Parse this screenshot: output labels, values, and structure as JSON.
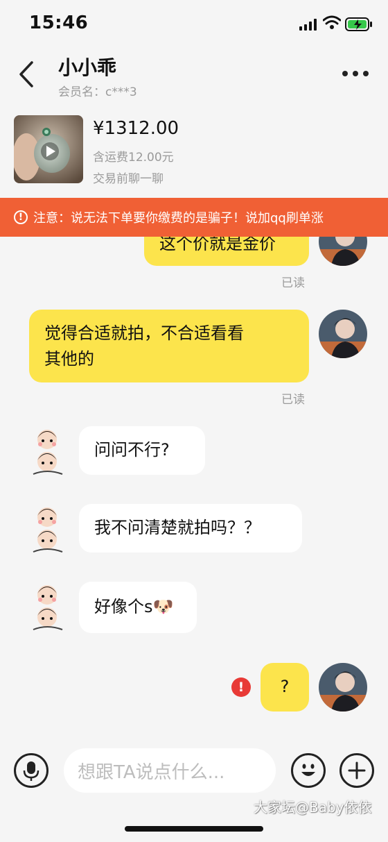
{
  "status_bar": {
    "time": "15:46"
  },
  "header": {
    "title": "小小乖",
    "subtitle": "会员名：c***3"
  },
  "product": {
    "price": "¥1312.00",
    "shipping": "含运费12.00元",
    "hint": "交易前聊一聊"
  },
  "banner": {
    "icon": "!",
    "text": "注意：说无法下单要你缴费的是骗子！说加qq刷单涨"
  },
  "messages": [
    {
      "side": "out",
      "text": "这个价就是金价",
      "status": "已读"
    },
    {
      "side": "out",
      "lines": [
        "觉得合适就拍，不合适看看",
        "其他的"
      ],
      "status": "已读"
    },
    {
      "side": "in",
      "text": "问问不行?"
    },
    {
      "side": "in",
      "text": "我不问清楚就拍吗？？"
    },
    {
      "side": "in",
      "text": "好像个s",
      "emoji": "🐶"
    },
    {
      "side": "out",
      "text": "?",
      "error_icon": "!"
    }
  ],
  "input": {
    "placeholder": "想跟TA说点什么..."
  },
  "icons": {
    "back": "chevron-left-icon",
    "more": "more-dots-icon",
    "mic": "microphone-icon",
    "emoji": "smiley-icon",
    "plus": "plus-icon",
    "play": "play-icon",
    "warning": "warning-icon",
    "error": "send-failed-icon"
  },
  "colors": {
    "accent_bubble": "#fce44c",
    "banner": "#f06035",
    "error": "#e83a36",
    "background": "#f5f5f5"
  },
  "watermark": "大家坛@Baby依依"
}
